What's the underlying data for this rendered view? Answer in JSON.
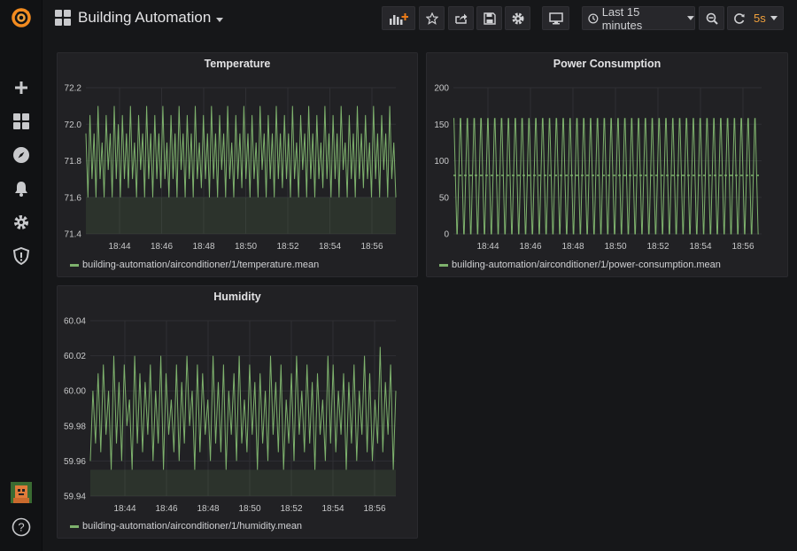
{
  "dashboard": {
    "title": "Building Automation"
  },
  "toolbar": {
    "time_range": "Last 15 minutes",
    "refresh_interval": "5s"
  },
  "colors": {
    "series": "#7eb26d",
    "accent": "#eb7b18",
    "refresh": "#f0a03c"
  },
  "panels": [
    {
      "title": "Temperature",
      "legend": "building-automation/airconditioner/1/temperature.mean",
      "y_ticks": [
        "72.2",
        "72.0",
        "71.8",
        "71.6",
        "71.4"
      ],
      "x_ticks": [
        "18:44",
        "18:46",
        "18:48",
        "18:50",
        "18:52",
        "18:54",
        "18:56"
      ]
    },
    {
      "title": "Power Consumption",
      "legend": "building-automation/airconditioner/1/power-consumption.mean",
      "y_ticks": [
        "200",
        "150",
        "100",
        "50",
        "0"
      ],
      "x_ticks": [
        "18:44",
        "18:46",
        "18:48",
        "18:50",
        "18:52",
        "18:54",
        "18:56"
      ]
    },
    {
      "title": "Humidity",
      "legend": "building-automation/airconditioner/1/humidity.mean",
      "y_ticks": [
        "60.04",
        "60.02",
        "60.00",
        "59.98",
        "59.96",
        "59.94"
      ],
      "x_ticks": [
        "18:44",
        "18:46",
        "18:48",
        "18:50",
        "18:52",
        "18:54",
        "18:56"
      ]
    }
  ],
  "chart_data": [
    {
      "type": "line",
      "title": "Temperature",
      "ylim": [
        71.4,
        72.2
      ],
      "x_range": [
        "18:43",
        "18:57"
      ],
      "series": [
        {
          "name": "building-automation/airconditioner/1/temperature.mean",
          "values": [
            71.95,
            71.6,
            72.05,
            71.7,
            71.95,
            71.6,
            72.1,
            71.7,
            71.9,
            71.6,
            72.05,
            71.75,
            71.95,
            71.6,
            72.1,
            71.7,
            72.0,
            71.6,
            72.05,
            71.7,
            71.95,
            71.65,
            72.1,
            71.7,
            71.9,
            71.6,
            72.05,
            71.75,
            71.95,
            71.6,
            72.1,
            71.7,
            71.95,
            71.6,
            72.05,
            71.7,
            71.95,
            71.65,
            72.1,
            71.7,
            71.9,
            71.6,
            72.05,
            71.7,
            71.95,
            71.6,
            72.1,
            71.75,
            71.95,
            71.6,
            72.05,
            71.7,
            71.95,
            71.6,
            72.1,
            71.7,
            71.9,
            71.65,
            72.05,
            71.7,
            71.95,
            71.6,
            72.1,
            71.7,
            71.95,
            71.6,
            72.05,
            71.75,
            71.95,
            71.6,
            72.1,
            71.7,
            71.9,
            71.6,
            72.05,
            71.7,
            71.95,
            71.65,
            72.1,
            71.7,
            71.95,
            71.6,
            72.05,
            71.7,
            71.9,
            71.6,
            72.1,
            71.75,
            71.95,
            71.6,
            72.05,
            71.7,
            71.95,
            71.6,
            72.1,
            71.7,
            71.95,
            71.65,
            72.05,
            71.7,
            71.95,
            71.6,
            72.1,
            71.7,
            71.9,
            71.6,
            72.05,
            71.75,
            71.95,
            71.6,
            72.1,
            71.7,
            71.95,
            71.6,
            72.05,
            71.7,
            71.9,
            71.65,
            72.1,
            71.7,
            71.95,
            71.6,
            72.05,
            71.7,
            71.95,
            71.6,
            72.1,
            71.75,
            71.9,
            71.6,
            72.05,
            71.7,
            71.95,
            71.6,
            72.1,
            71.7,
            71.95,
            71.65,
            72.05,
            71.7,
            71.9,
            71.6,
            72.1,
            71.7,
            71.95,
            71.6,
            72.05,
            71.75,
            71.95,
            71.6,
            72.1,
            71.7,
            71.9,
            71.6
          ]
        }
      ]
    },
    {
      "type": "line",
      "title": "Power Consumption",
      "ylim": [
        0,
        200
      ],
      "x_range": [
        "18:43",
        "18:57"
      ],
      "series": [
        {
          "name": "building-automation/airconditioner/1/power-consumption.mean",
          "values": [
            158,
            0,
            158,
            0,
            158,
            0,
            158,
            0,
            158,
            0,
            158,
            0,
            158,
            0,
            158,
            0,
            158,
            0,
            158,
            0,
            158,
            0,
            158,
            0,
            158,
            0,
            158,
            0,
            158,
            0,
            158,
            0,
            158,
            0,
            158,
            0,
            158,
            0,
            158,
            0,
            158,
            0,
            158,
            0,
            158,
            0,
            158,
            0,
            158,
            0,
            158,
            0,
            158,
            0,
            158,
            0,
            158,
            0,
            158,
            0,
            158,
            0,
            158,
            0,
            158,
            0,
            158,
            0,
            158,
            0,
            158,
            0,
            158,
            0,
            158,
            0,
            158,
            0,
            158,
            0,
            158,
            0,
            158,
            0,
            158,
            0,
            158,
            0,
            158,
            0
          ]
        }
      ]
    },
    {
      "type": "line",
      "title": "Humidity",
      "ylim": [
        59.94,
        60.04
      ],
      "x_range": [
        "18:43",
        "18:57"
      ],
      "series": [
        {
          "name": "building-automation/airconditioner/1/humidity.mean",
          "values": [
            59.96,
            60.0,
            59.97,
            60.01,
            59.965,
            60.015,
            59.975,
            60.0,
            59.955,
            60.02,
            59.97,
            60.005,
            59.96,
            60.015,
            59.98,
            59.995,
            59.955,
            60.02,
            59.97,
            60.01,
            59.965,
            60.005,
            59.975,
            60.015,
            59.96,
            60.0,
            59.97,
            60.02,
            59.955,
            60.01,
            59.975,
            59.995,
            59.965,
            60.015,
            59.96,
            60.005,
            59.97,
            60.02,
            59.98,
            60.0,
            59.955,
            60.015,
            59.965,
            60.01,
            59.975,
            59.995,
            59.96,
            60.02,
            59.97,
            60.005,
            59.965,
            60.015,
            59.955,
            60.0,
            59.975,
            60.01,
            59.96,
            60.02,
            59.97,
            59.995,
            59.965,
            60.015,
            59.975,
            60.005,
            59.955,
            60.01,
            59.97,
            60.0,
            59.96,
            60.02,
            59.975,
            60.005,
            59.965,
            60.015,
            59.955,
            59.995,
            59.97,
            60.01,
            59.96,
            60.02,
            59.975,
            60.0,
            59.965,
            60.015,
            59.97,
            60.005,
            59.955,
            60.01,
            59.975,
            59.995,
            59.96,
            60.02,
            59.97,
            60.015,
            59.965,
            60.0,
            59.975,
            60.01,
            59.955,
            60.005,
            59.97,
            60.015,
            59.96,
            60.0,
            59.975,
            60.02,
            59.965,
            60.01,
            59.96,
            59.995,
            59.97,
            60.025,
            59.965,
            60.005,
            59.975,
            60.015,
            59.955,
            60.0
          ]
        }
      ]
    }
  ]
}
